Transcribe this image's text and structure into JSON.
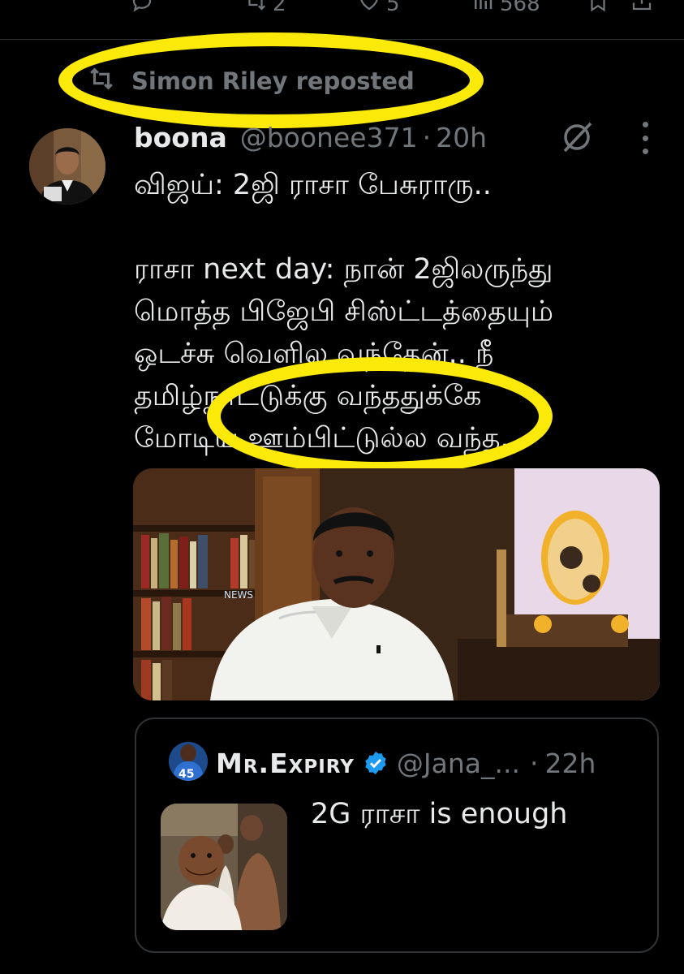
{
  "actions": {
    "reply_icon": "reply-icon",
    "repost_icon": "repost-icon",
    "repost_count": "2",
    "like_icon": "heart-icon",
    "like_count": "5",
    "views_icon": "views-icon",
    "views_count": "568",
    "bookmark_icon": "bookmark-icon",
    "share_icon": "share-icon"
  },
  "repost": {
    "icon": "repost-icon",
    "text": "Simon Riley reposted"
  },
  "tweet": {
    "author": "boona",
    "handle": "@boonee371",
    "separator": "·",
    "time": "20h",
    "text_lines": [
      "விஜய்: 2ஜி ராசா பேசுராரு..",
      "",
      "ராசா next day: நான் 2ஜிலருந்து",
      "மொத்த பிஜேபி சிஸ்ட்டத்தையும்",
      "ஒடச்சு வெளில வந்தேன்.. நீ",
      "தமிழ்நாட்டுக்கு வந்ததுக்கே",
      "மோடிய ஊம்பிட்டுல்ல வந்த.."
    ]
  },
  "quote": {
    "name": "Mr.Expiry",
    "handle": "@Jana_...",
    "separator": "·",
    "time": "22h",
    "jersey_number": "45",
    "text": "2G ராசா is enough"
  },
  "colors": {
    "background": "#000000",
    "text": "#e7e9ea",
    "muted": "#71767b",
    "border": "#2f3336",
    "highlight": "#fbe90a",
    "verified": "#1d9bf0"
  }
}
